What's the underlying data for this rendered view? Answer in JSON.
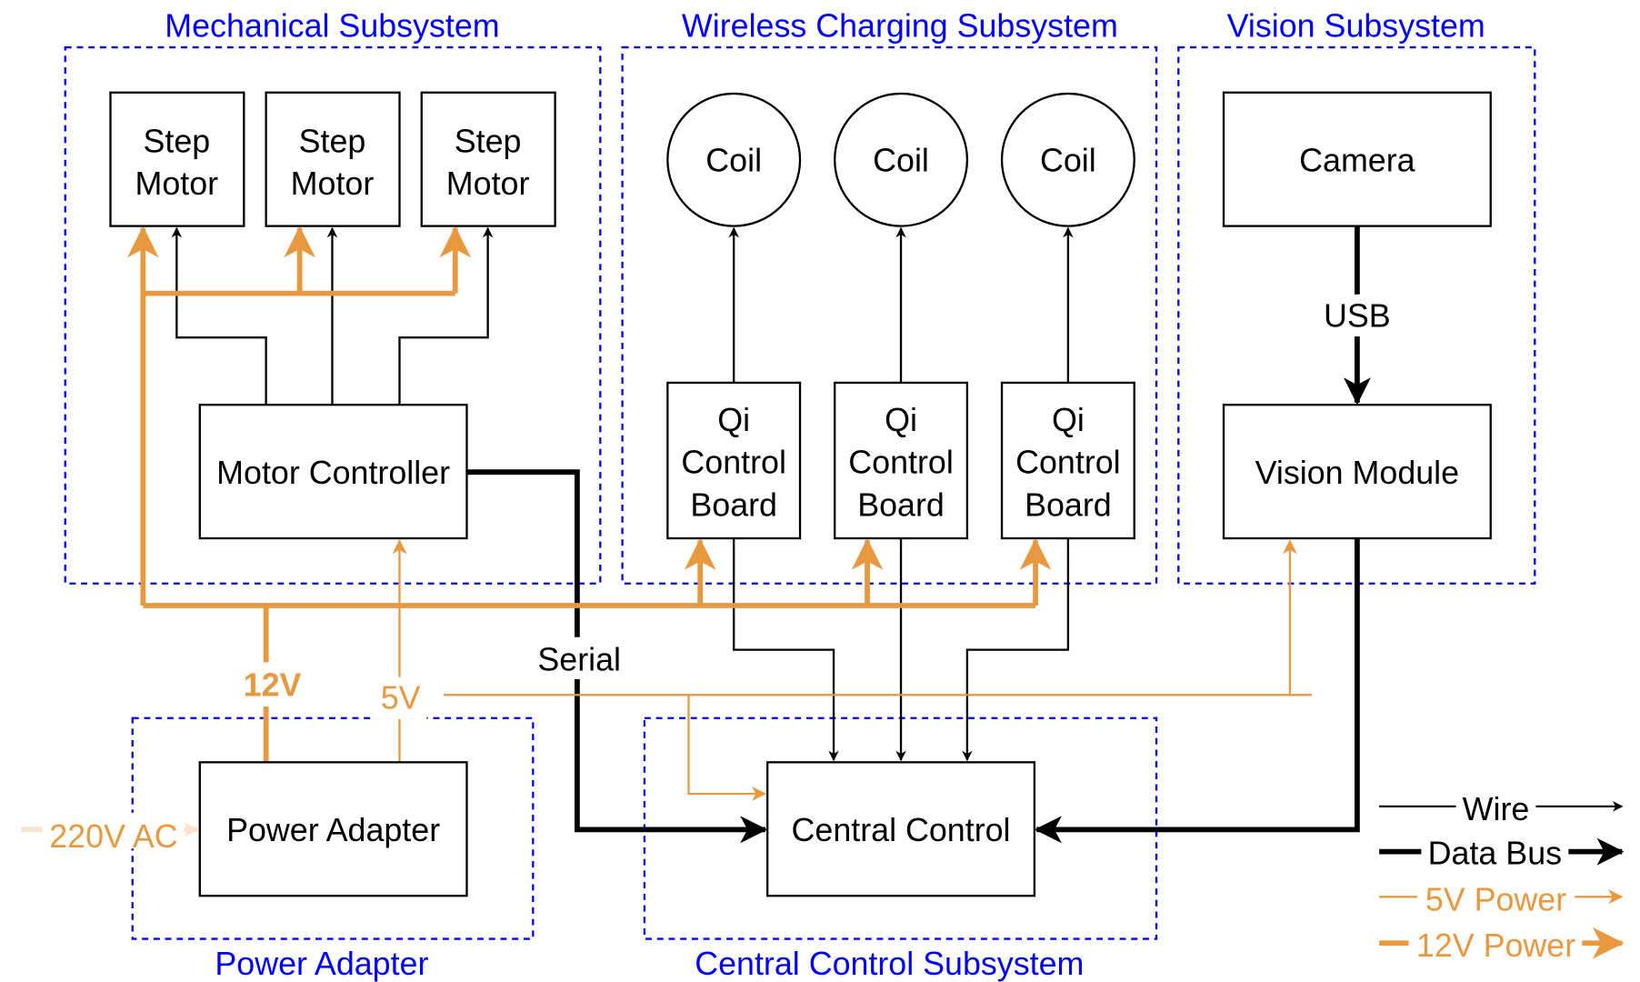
{
  "colors": {
    "group": "#0000ff",
    "power": "#e8993f",
    "wire": "#000000"
  },
  "groups": {
    "mechanical": "Mechanical Subsystem",
    "wireless": "Wireless Charging Subsystem",
    "vision": "Vision Subsystem",
    "power": "Power Adapter",
    "central": "Central Control Subsystem"
  },
  "nodes": {
    "step_motor": [
      "Step",
      "Motor"
    ],
    "motor_controller": "Motor Controller",
    "coil": "Coil",
    "qi_board": [
      "Qi",
      "Control",
      "Board"
    ],
    "camera": "Camera",
    "vision_module": "Vision Module",
    "power_adapter": "Power Adapter",
    "central_control": "Central Control"
  },
  "labels": {
    "usb": "USB",
    "serial": "Serial",
    "v12": "12V",
    "v5": "5V",
    "ac": "220V AC"
  },
  "legend": [
    {
      "label": "Wire",
      "style": "wire"
    },
    {
      "label": "Data Bus",
      "style": "data-bus"
    },
    {
      "label": "5V Power",
      "style": "5v-power"
    },
    {
      "label": "12V Power",
      "style": "12v-power"
    }
  ]
}
